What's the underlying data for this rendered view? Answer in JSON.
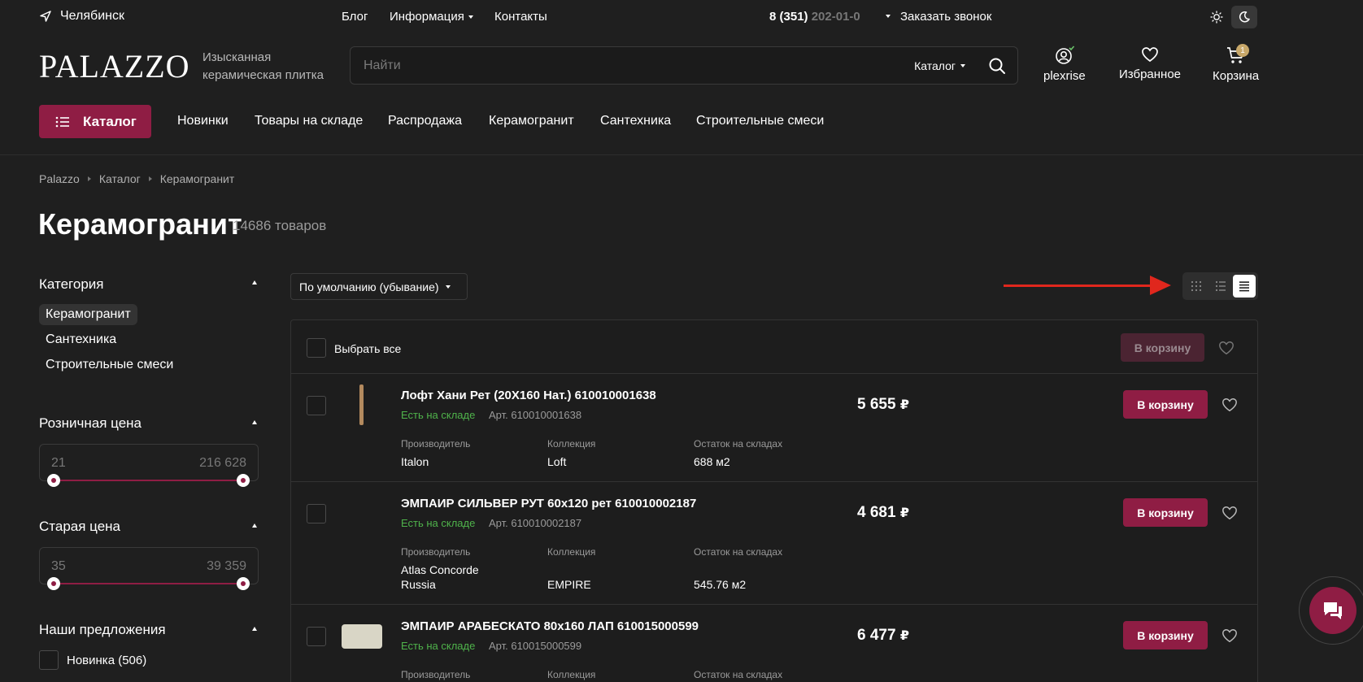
{
  "topbar": {
    "city": "Челябинск",
    "nav": [
      {
        "label": "Блог"
      },
      {
        "label": "Информация"
      },
      {
        "label": "Контакты"
      }
    ],
    "phone_main": "8 (351)",
    "phone_tail": " 202-01-0",
    "callback": "Заказать звонок"
  },
  "header": {
    "logo": "PALAZZO",
    "tagline_1": "Изысканная",
    "tagline_2": "керамическая плитка",
    "search_placeholder": "Найти",
    "search_scope": "Каталог",
    "user": "plexrise",
    "favorites": "Избранное",
    "cart": "Корзина",
    "cart_count": "1"
  },
  "nav": {
    "catalog": "Каталог",
    "items": [
      "Новинки",
      "Товары на складе",
      "Распродажа",
      "Керамогранит",
      "Сантехника",
      "Строительные смеси"
    ]
  },
  "breadcrumb": [
    "Palazzo",
    "Каталог",
    "Керамогранит"
  ],
  "page": {
    "title": "Керамогранит",
    "count": "14686 товаров"
  },
  "sidebar": {
    "category_title": "Категория",
    "categories": [
      {
        "label": "Керамогранит",
        "active": true
      },
      {
        "label": "Сантехника",
        "active": false
      },
      {
        "label": "Строительные смеси",
        "active": false
      }
    ],
    "retail_price": {
      "title": "Розничная цена",
      "min": "21",
      "max": "216 628"
    },
    "old_price": {
      "title": "Старая цена",
      "min": "35",
      "max": "39 359"
    },
    "offers": {
      "title": "Наши предложения",
      "items": [
        "Новинка (506)"
      ]
    }
  },
  "toolbar": {
    "sort": "По умолчанию (убывание)",
    "view_modes": [
      "grid-view-icon",
      "list-view-icon",
      "table-view-icon"
    ],
    "active_view": "table-view-icon"
  },
  "table": {
    "select_all": "Выбрать все",
    "cart_label": "В корзину",
    "labels": {
      "manufacturer": "Производитель",
      "collection": "Коллекция",
      "stock": "Остаток на складах"
    },
    "rows": [
      {
        "name": "Лофт Хани Рет (20X160 Нат.) 610010001638",
        "availability": "Есть на складе",
        "article": "Арт. 610010001638",
        "manufacturer_1": "Italon",
        "manufacturer_2": "",
        "collection": "Loft",
        "stock": "688 м2",
        "price": "5 655",
        "currency": "₽"
      },
      {
        "name": "ЭМПАИР СИЛЬВЕР РУТ 60x120 рет 610010002187",
        "availability": "Есть на складе",
        "article": "Арт. 610010002187",
        "manufacturer_1": "Atlas Concorde",
        "manufacturer_2": "Russia",
        "collection": "EMPIRE",
        "stock": "545.76 м2",
        "price": "4 681",
        "currency": "₽"
      },
      {
        "name": "ЭМПАИР АРАБЕСКАТО 80x160 ЛАП 610015000599",
        "availability": "Есть на складе",
        "article": "Арт. 610015000599",
        "manufacturer_1": "",
        "manufacturer_2": "",
        "collection": "",
        "stock": "",
        "price": "6 477",
        "currency": "₽"
      }
    ]
  },
  "colors": {
    "accent": "#8f1d44",
    "stock_green": "#4fb34b",
    "arrow_red": "#e0271d"
  }
}
